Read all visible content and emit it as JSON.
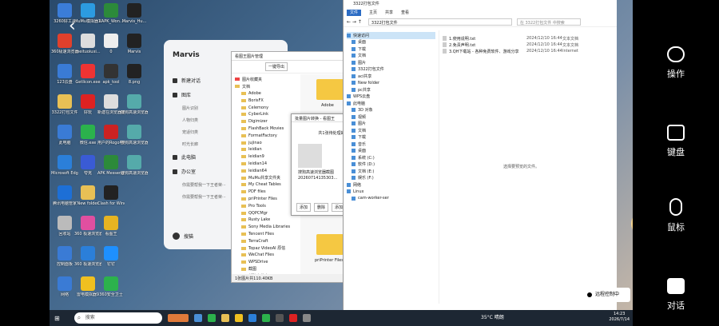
{
  "back_arrow": "‹",
  "desktop_icons": [
    {
      "label": "3260好工具",
      "color": "#3b7dd8"
    },
    {
      "label": "MuMu模拟器12",
      "color": "#2c9be0"
    },
    {
      "label": "XAPK_Won...",
      "color": "#2c8a3a"
    },
    {
      "label": "Marvis_Hu...",
      "color": "#222"
    },
    {
      "label": "360极速浏览器",
      "color": "#e0402c"
    },
    {
      "label": "meituoiuxi...",
      "color": "#ddd"
    },
    {
      "label": "0",
      "color": "#eee"
    },
    {
      "label": "Marvis",
      "color": "#222"
    },
    {
      "label": "123云盘",
      "color": "#3a7bd5"
    },
    {
      "label": "Getlicon.exe",
      "color": "#e33"
    },
    {
      "label": "apk_tool",
      "color": "#333"
    },
    {
      "label": "8.png",
      "color": "#222"
    },
    {
      "label": "3322打包文件",
      "color": "#e8c055"
    },
    {
      "label": "好玩",
      "color": "#d22"
    },
    {
      "label": "新建在浏览器运行...",
      "color": "#ddd"
    },
    {
      "label": "搜狗高速浏览器2023...",
      "color": "#5aa"
    },
    {
      "label": "此电脑",
      "color": "#3a7bd5"
    },
    {
      "label": "微信.exe",
      "color": "#2bb24c"
    },
    {
      "label": "用户的Rogo电脑软件...",
      "color": "#c22"
    },
    {
      "label": "搜狗高速浏览器2023...",
      "color": "#5aa"
    },
    {
      "label": "Microsoft Edge",
      "color": "#2b7fd9"
    },
    {
      "label": "夸克",
      "color": "#3a5bd5"
    },
    {
      "label": "APK Messenger...",
      "color": "#2c8a3a"
    },
    {
      "label": "搜狗高速浏览器2023...",
      "color": "#5aa"
    },
    {
      "label": "腾讯电脑管家",
      "color": "#1d6fd6"
    },
    {
      "label": "New folder",
      "color": "#e8c055"
    },
    {
      "label": "Clash for Windows...",
      "color": "#222"
    },
    {
      "label": "回收站",
      "color": "#bbb"
    },
    {
      "label": "360 极速浏览器X",
      "color": "#e04fa0"
    },
    {
      "label": "看图王",
      "color": "#e6b422"
    },
    {
      "label": "控制面板",
      "color": "#3a7bd5"
    },
    {
      "label": "360 极速浏览器X",
      "color": "#2b7fd9"
    },
    {
      "label": "钉钉",
      "color": "#1e90ff"
    },
    {
      "label": "网络",
      "color": "#3a7bd5"
    },
    {
      "label": "雷电模拟器9",
      "color": "#f0c020"
    },
    {
      "label": "360安全卫士",
      "color": "#2cb24c"
    }
  ],
  "right_panel": {
    "settings": "操作",
    "keyboard": "键盘",
    "mouse": "鼠标",
    "chat": "对话"
  },
  "taskbar": {
    "search_placeholder": "搜索",
    "weather": "35°C 晴朗",
    "time": "14:23",
    "date": "2026/7/14"
  },
  "marvis": {
    "title": "Marvis",
    "new_chat": "新建对话",
    "gallery": "图库",
    "gallery_items": [
      "图片识别",
      "人物归类",
      "宠适归类",
      "时光长廊"
    ],
    "this_pc": "此电脑",
    "office": "办公室",
    "recent": [
      "你需要帮我一下王者荣···",
      "你需要帮我一下王者荣···"
    ],
    "user": "搜猫"
  },
  "image_manager": {
    "title": "看图王图片管理",
    "import_button": "一键导出",
    "tree_root": "图片收藏夹",
    "tree_doc": "文档",
    "folders": [
      "Adobe",
      "BorisFX",
      "Celemony",
      "CyberLink",
      "Digimizer",
      "FlashBack Movies",
      "FormatFactory",
      "jujinao",
      "leidian",
      "leidian9",
      "leidian14",
      "leidian64",
      "MuMu共享文件夹",
      "My Cheat Tables",
      "PDF files",
      "priPrinter Files",
      "Pro Tools",
      "QQPCMgr",
      "Rusty Lake",
      "Sony Media Libraries",
      "Tencent Files",
      "TerraCraft",
      "Topaz VideoAI 原信",
      "WeChat Files",
      "WPSDrive",
      "截图",
      "新建文件夹"
    ],
    "right_labels": [
      "Adobe",
      "priPrinter Files"
    ],
    "status": "1张图片共110.40KB"
  },
  "convert_dialog": {
    "title": "批量图片转换 - 看图王",
    "message": "共1张待处理的图片",
    "filename": "搜狗高速浏览器截图20260714135303...",
    "buttons": [
      "添加",
      "删除",
      "添加文件夹"
    ]
  },
  "explorer": {
    "title": "3322打包文件",
    "menu": [
      "文件",
      "主页",
      "共享",
      "查看"
    ],
    "address": "3322打包文件",
    "search": "在 3322打包文件 中搜索",
    "nav": [
      {
        "label": "快速访问",
        "sel": true,
        "sub": false
      },
      {
        "label": "桌面",
        "sel": false,
        "sub": true
      },
      {
        "label": "下载",
        "sel": false,
        "sub": true
      },
      {
        "label": "文档",
        "sel": false,
        "sub": true
      },
      {
        "label": "图片",
        "sel": false,
        "sub": true
      },
      {
        "label": "3322打包文件",
        "sel": false,
        "sub": true
      },
      {
        "label": "aci共享",
        "sel": false,
        "sub": true
      },
      {
        "label": "New folder",
        "sel": false,
        "sub": true
      },
      {
        "label": "pc共享",
        "sel": false,
        "sub": true
      },
      {
        "label": "WPS云盘",
        "sel": false,
        "sub": false
      },
      {
        "label": "此电脑",
        "sel": false,
        "sub": false
      },
      {
        "label": "3D 对象",
        "sel": false,
        "sub": true
      },
      {
        "label": "视频",
        "sel": false,
        "sub": true
      },
      {
        "label": "图片",
        "sel": false,
        "sub": true
      },
      {
        "label": "文档",
        "sel": false,
        "sub": true
      },
      {
        "label": "下载",
        "sel": false,
        "sub": true
      },
      {
        "label": "音乐",
        "sel": false,
        "sub": true
      },
      {
        "label": "桌面",
        "sel": false,
        "sub": true
      },
      {
        "label": "系统 (C:)",
        "sel": false,
        "sub": true
      },
      {
        "label": "软件 (D:)",
        "sel": false,
        "sub": true
      },
      {
        "label": "文档 (E:)",
        "sel": false,
        "sub": true
      },
      {
        "label": "娱乐 (F:)",
        "sel": false,
        "sub": true
      },
      {
        "label": "网络",
        "sel": false,
        "sub": false
      },
      {
        "label": "Linux",
        "sel": false,
        "sub": false
      },
      {
        "label": "cam-worker-ser",
        "sel": false,
        "sub": true
      }
    ],
    "files": [
      {
        "name": "1.使用说明.txt",
        "date": "2024/12/10 16:44",
        "type": "文本文档"
      },
      {
        "name": "2.免责声明.txt",
        "date": "2024/12/10 16:44",
        "type": "文本文档"
      },
      {
        "name": "3.QH下载站 - 各种免费软件、游戏分享",
        "date": "2024/12/10 16:44",
        "type": "Internet"
      }
    ],
    "preview_text": "选择要预览的文件。"
  },
  "remote_control": "远程控制中"
}
